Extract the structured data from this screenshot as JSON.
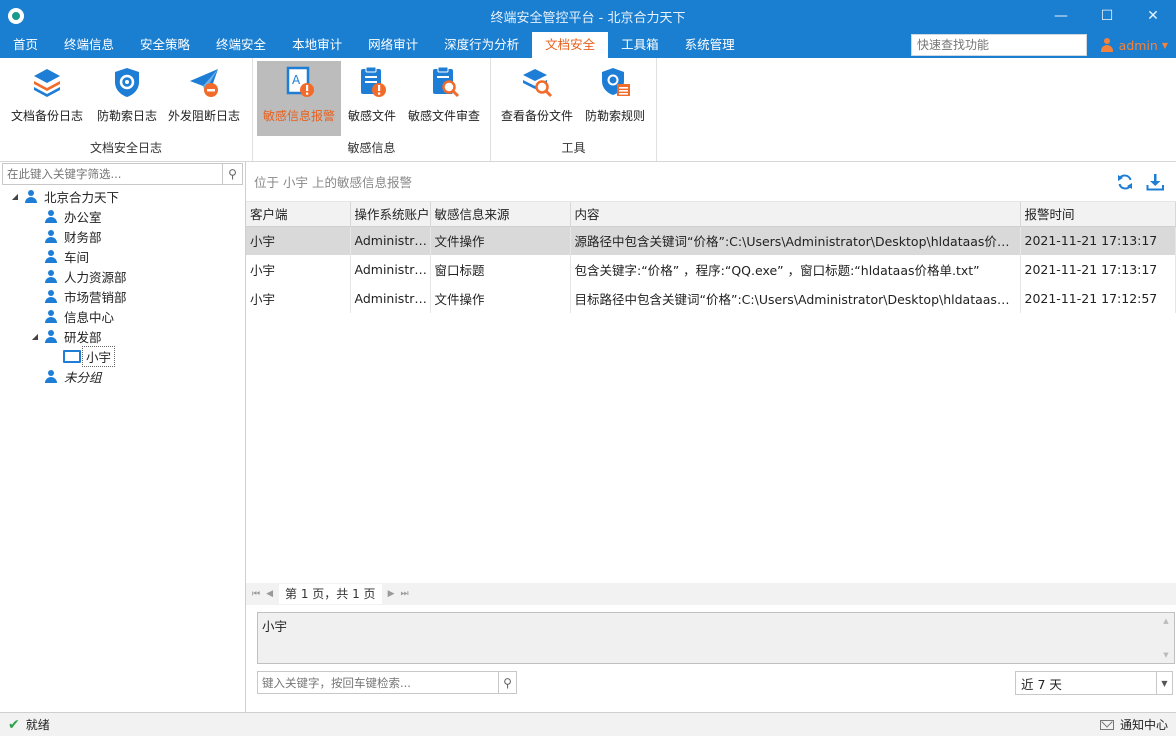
{
  "window": {
    "title": "终端安全管控平台 - 北京合力天下"
  },
  "menu": {
    "items": [
      "首页",
      "终端信息",
      "安全策略",
      "终端安全",
      "本地审计",
      "网络审计",
      "深度行为分析",
      "文档安全",
      "工具箱",
      "系统管理"
    ],
    "active_index": 7,
    "search_placeholder": "快速查找功能",
    "user": "admin"
  },
  "ribbon": {
    "groups": [
      {
        "label": "文档安全日志",
        "buttons": [
          "文档备份日志",
          "防勒索日志",
          "外发阻断日志"
        ]
      },
      {
        "label": "敏感信息",
        "buttons": [
          "敏感信息报警",
          "敏感文件",
          "敏感文件审查"
        ]
      },
      {
        "label": "工具",
        "buttons": [
          "查看备份文件",
          "防勒索规则"
        ]
      }
    ],
    "active_button": "敏感信息报警"
  },
  "left_panel": {
    "filter_placeholder": "在此键入关键字筛选...",
    "tree": {
      "root": "北京合力天下",
      "children": [
        "办公室",
        "财务部",
        "车间",
        "人力资源部",
        "市场营销部",
        "信息中心",
        "研发部",
        "未分组"
      ],
      "rd_child": "小宇"
    }
  },
  "content": {
    "header": "位于 小宇 上的敏感信息报警",
    "columns": [
      "客户端",
      "操作系统账户",
      "敏感信息来源",
      "内容",
      "报警时间"
    ],
    "rows": [
      [
        "小宇",
        "Administra...",
        "文件操作",
        "源路径中包含关键词“价格”:C:\\Users\\Administrator\\Desktop\\hldataas价格...",
        "2021-11-21 17:13:17"
      ],
      [
        "小宇",
        "Administra...",
        "窗口标题",
        "包含关键字:“价格” ，程序:“QQ.exe” ，窗口标题:“hldataas价格单.txt”",
        "2021-11-21 17:13:17"
      ],
      [
        "小宇",
        "Administra...",
        "文件操作",
        "目标路径中包含关键词“价格”:C:\\Users\\Administrator\\Desktop\\hldataas价...",
        "2021-11-21 17:12:57"
      ]
    ],
    "pager": "第 1 页，共 1 页",
    "detail_text": "小宇",
    "keyword_placeholder": "键入关键字，按回车键检索...",
    "range_value": "近 7 天"
  },
  "status": {
    "text": "就绪",
    "notice": "通知中心"
  },
  "colors": {
    "brand": "#1a7ed1",
    "accent": "#e8601c"
  }
}
